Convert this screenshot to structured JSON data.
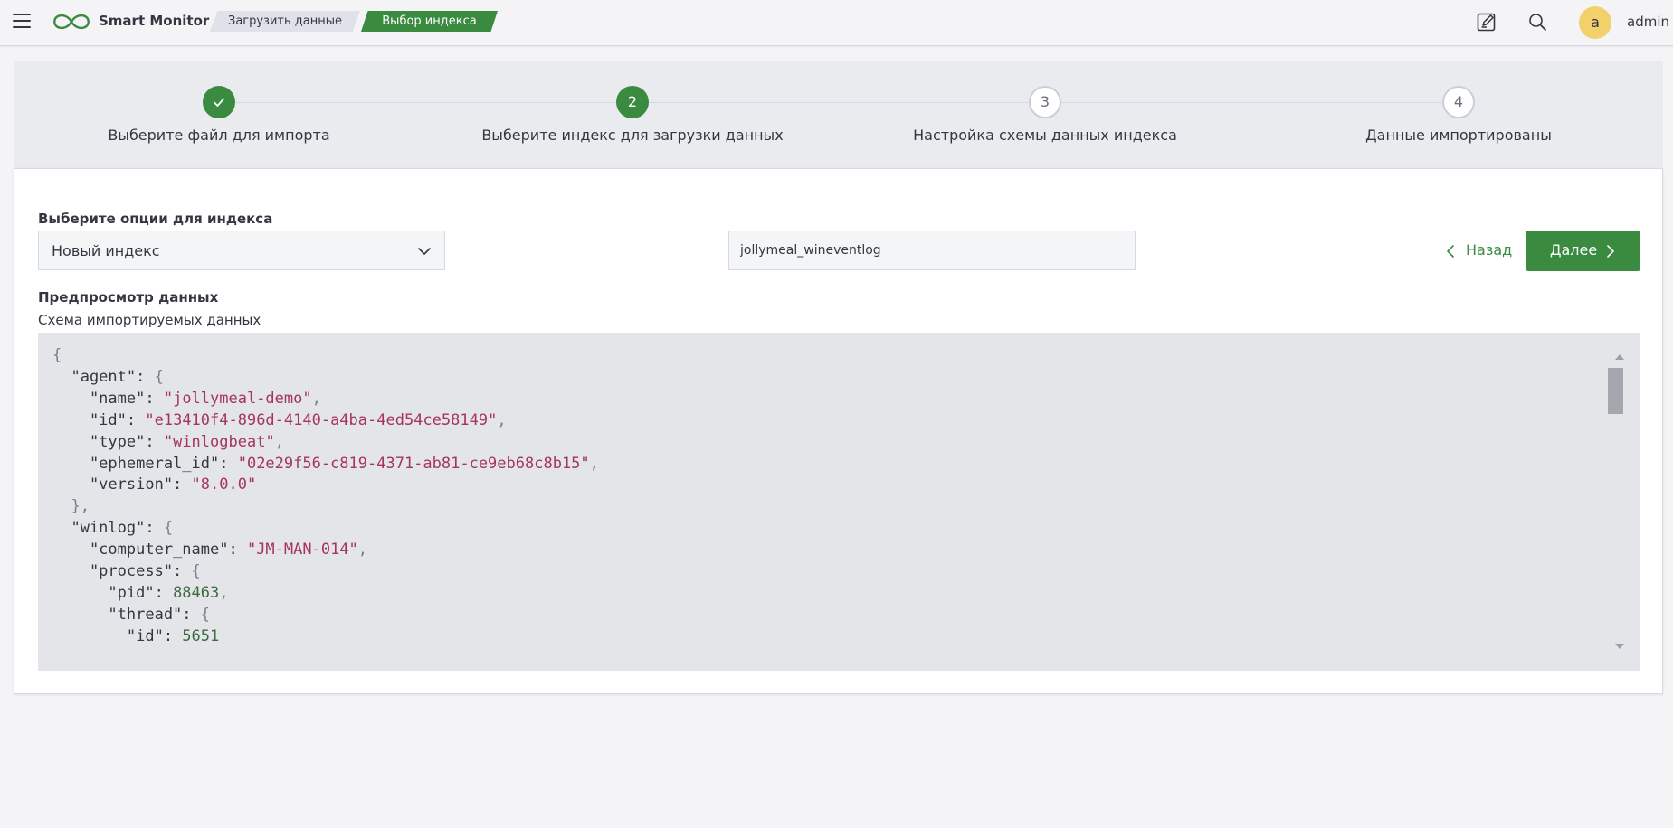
{
  "header": {
    "brand": "Smart Monitor",
    "breadcrumbs": [
      "Загрузить данные",
      "Выбор индекса"
    ],
    "icons": [
      "menu-icon",
      "infinity-logo-icon",
      "edit-icon",
      "search-icon"
    ],
    "avatar_initial": "a",
    "username": "admin",
    "accent_color": "#3a8a3f",
    "avatar_color": "#f2d16b"
  },
  "steps": [
    {
      "number": "",
      "title": "Выберите файл для импорта",
      "status": "complete"
    },
    {
      "number": "2",
      "title": "Выберите индекс для загрузки данных",
      "status": "current"
    },
    {
      "number": "3",
      "title": "Настройка схемы данных индекса",
      "status": "incomplete"
    },
    {
      "number": "4",
      "title": "Данные импортированы",
      "status": "incomplete"
    }
  ],
  "form": {
    "options_label": "Выберите опции для индекса",
    "index_option": "Новый индекс",
    "index_name": "jollymeal_wineventlog",
    "back_label": "Назад",
    "next_label": "Далее"
  },
  "preview": {
    "title": "Предпросмотр данных",
    "subtitle": "Схема импортируемых данных",
    "agent": {
      "name": "jollymeal-demo",
      "id": "e13410f4-896d-4140-a4ba-4ed54ce58149",
      "type": "winlogbeat",
      "ephemeral_id": "02e29f56-c819-4371-ab81-ce9eb68c8b15",
      "version": "8.0.0"
    },
    "winlog": {
      "computer_name": "JM-MAN-014",
      "process_pid": "88463",
      "thread_id": "5651"
    }
  }
}
